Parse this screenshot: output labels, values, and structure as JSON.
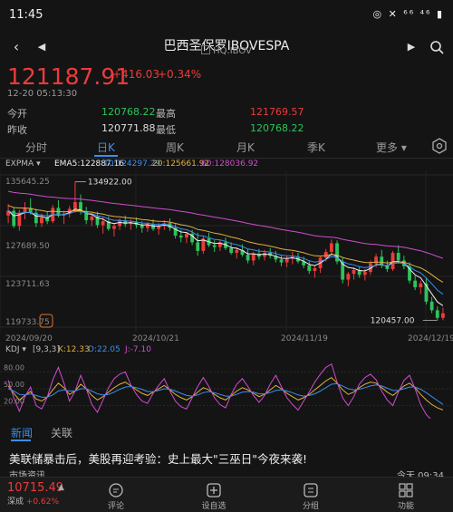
{
  "status": {
    "time": "11:45",
    "icons_text": "◎ ✕ ⁶⁶ ⁴⁶ ▮"
  },
  "nav": {
    "title": "巴西圣保罗IBOVESPA",
    "subtitle": "HQ.IBOV"
  },
  "quote": {
    "price": "121187.91",
    "change": "+416.03",
    "change_pct": "+0.34%",
    "time": "12-20 05:13:30",
    "open_label": "今开",
    "open": "120768.22",
    "high_label": "最高",
    "high": "121769.57",
    "prev_label": "昨收",
    "prev": "120771.88",
    "low_label": "最低",
    "low": "120768.22"
  },
  "tabs": [
    "分时",
    "日K",
    "周K",
    "月K",
    "季K",
    "更多"
  ],
  "active_tab": 1,
  "indicator": {
    "name": "EXPMA",
    "ema5": "EMA5:122887.16",
    "ema10": "10:124297.29",
    "ema20": "20:125661.92",
    "ema60": "60:128036.92"
  },
  "kdj": {
    "name": "KDJ",
    "params": "[9,3,3]",
    "k": "K:12.33",
    "d": "D:22.05",
    "j": "J:-7.10"
  },
  "chart_data": {
    "type": "candlestick",
    "y_ticks": [
      "135645.25",
      "127689.50",
      "123711.63",
      "119733.75"
    ],
    "ylim": [
      119733.75,
      135645.25
    ],
    "max_label": "134922.00",
    "min_label": "120457.00",
    "x_ticks": [
      "2024/09/20",
      "2024/10/21",
      "2024/11/19",
      "2024/12/19"
    ],
    "kdj_ticks": [
      "80.00",
      "50.00",
      "20.00"
    ],
    "kdj_ylim": [
      0,
      100
    ],
    "candles": [
      [
        131400,
        132600,
        130600,
        131900
      ],
      [
        131900,
        132200,
        130100,
        130300
      ],
      [
        130300,
        132000,
        129800,
        131700
      ],
      [
        131700,
        132800,
        131000,
        132200
      ],
      [
        132200,
        133200,
        131500,
        131700
      ],
      [
        131700,
        132100,
        130200,
        130600
      ],
      [
        130600,
        131600,
        130200,
        131200
      ],
      [
        131200,
        131800,
        130500,
        130800
      ],
      [
        130800,
        132500,
        130600,
        132200
      ],
      [
        132200,
        133000,
        131200,
        131400
      ],
      [
        131400,
        131900,
        130500,
        131600
      ],
      [
        131600,
        132400,
        131200,
        132100
      ],
      [
        132100,
        134922,
        131700,
        132800
      ],
      [
        132800,
        133600,
        131500,
        131800
      ],
      [
        131800,
        132300,
        130500,
        130900
      ],
      [
        130900,
        131600,
        130300,
        131300
      ],
      [
        131300,
        131800,
        130100,
        130400
      ],
      [
        130400,
        131200,
        129500,
        130800
      ],
      [
        130800,
        131300,
        129800,
        130000
      ],
      [
        130000,
        130600,
        129200,
        130300
      ],
      [
        130300,
        131100,
        129900,
        130900
      ],
      [
        130900,
        131400,
        130200,
        130500
      ],
      [
        130500,
        131000,
        129900,
        130700
      ],
      [
        130700,
        131200,
        130100,
        130400
      ],
      [
        130400,
        130800,
        129600,
        130100
      ],
      [
        130100,
        130700,
        129700,
        130500
      ],
      [
        130500,
        131000,
        129800,
        130000
      ],
      [
        130000,
        130600,
        129400,
        130300
      ],
      [
        130300,
        130900,
        129900,
        130600
      ],
      [
        130600,
        131100,
        129800,
        130100
      ],
      [
        130100,
        130500,
        129000,
        129300
      ],
      [
        129300,
        129900,
        128600,
        129100
      ],
      [
        129100,
        129700,
        128500,
        129500
      ],
      [
        129500,
        129900,
        128300,
        128600
      ],
      [
        128600,
        129600,
        127200,
        127700
      ],
      [
        127700,
        129200,
        127400,
        129000
      ],
      [
        129000,
        129600,
        128100,
        128300
      ],
      [
        128300,
        128800,
        127600,
        128100
      ],
      [
        128100,
        128900,
        127700,
        128600
      ],
      [
        128600,
        129100,
        127800,
        128000
      ],
      [
        128000,
        128600,
        127300,
        127500
      ],
      [
        127500,
        128100,
        126900,
        127800
      ],
      [
        127800,
        128400,
        127100,
        127300
      ],
      [
        127300,
        127900,
        126400,
        126700
      ],
      [
        126700,
        127600,
        126200,
        127400
      ],
      [
        127400,
        127900,
        126800,
        127100
      ],
      [
        127100,
        127800,
        126700,
        127500
      ],
      [
        127500,
        128000,
        126900,
        127200
      ],
      [
        127200,
        127700,
        126500,
        126800
      ],
      [
        126800,
        127300,
        126100,
        126500
      ],
      [
        126500,
        127200,
        126000,
        126900
      ],
      [
        126900,
        127600,
        126300,
        127100
      ],
      [
        127100,
        127500,
        126400,
        126600
      ],
      [
        126600,
        127100,
        125900,
        126200
      ],
      [
        126200,
        126700,
        125300,
        125600
      ],
      [
        125600,
        126200,
        124900,
        125900
      ],
      [
        125900,
        127200,
        125400,
        127000
      ],
      [
        127000,
        127900,
        126600,
        127600
      ],
      [
        127600,
        128900,
        127200,
        128500
      ],
      [
        128500,
        128800,
        126300,
        126600
      ],
      [
        126600,
        127000,
        124300,
        124700
      ],
      [
        124700,
        125500,
        124000,
        125300
      ],
      [
        125300,
        126000,
        124700,
        125700
      ],
      [
        125700,
        126100,
        124900,
        125200
      ],
      [
        125200,
        125800,
        124600,
        125500
      ],
      [
        125500,
        126700,
        125200,
        126400
      ],
      [
        126400,
        127400,
        126000,
        127100
      ],
      [
        127100,
        127800,
        125900,
        126200
      ],
      [
        126200,
        126700,
        125500,
        125800
      ],
      [
        125800,
        127700,
        125600,
        127500
      ],
      [
        127500,
        128300,
        126400,
        126700
      ],
      [
        126700,
        127200,
        125800,
        126100
      ],
      [
        126100,
        126500,
        124300,
        124600
      ],
      [
        124600,
        125100,
        123600,
        123900
      ],
      [
        123900,
        124600,
        123200,
        124300
      ],
      [
        124300,
        124900,
        122100,
        122400
      ],
      [
        122400,
        122900,
        121200,
        121500
      ],
      [
        121500,
        121900,
        120457,
        120700
      ],
      [
        120700,
        121769,
        120457,
        121188
      ]
    ],
    "kdj_k": [
      55,
      42,
      30,
      38,
      45,
      32,
      28,
      35,
      48,
      60,
      52,
      40,
      46,
      58,
      50,
      38,
      30,
      36,
      44,
      52,
      58,
      62,
      55,
      48,
      42,
      38,
      44,
      50,
      56,
      48,
      40,
      34,
      30,
      36,
      44,
      52,
      48,
      40,
      34,
      30,
      38,
      46,
      52,
      48,
      42,
      36,
      40,
      48,
      56,
      50,
      42,
      36,
      30,
      34,
      40,
      48,
      56,
      64,
      70,
      60,
      48,
      40,
      44,
      52,
      58,
      62,
      60,
      52,
      44,
      38,
      46,
      55,
      60,
      52,
      40,
      30,
      22,
      16,
      12.33
    ],
    "kdj_d": [
      50,
      46,
      40,
      39,
      41,
      38,
      35,
      35,
      39,
      46,
      48,
      46,
      46,
      50,
      50,
      46,
      41,
      39,
      40,
      44,
      49,
      53,
      54,
      52,
      49,
      45,
      45,
      47,
      50,
      49,
      46,
      42,
      38,
      37,
      39,
      43,
      45,
      43,
      40,
      37,
      37,
      40,
      44,
      45,
      44,
      41,
      41,
      43,
      47,
      48,
      46,
      43,
      39,
      37,
      38,
      41,
      46,
      52,
      58,
      59,
      55,
      50,
      48,
      49,
      52,
      55,
      57,
      55,
      51,
      47,
      47,
      50,
      53,
      53,
      49,
      43,
      36,
      29,
      22.05
    ],
    "kdj_j": [
      65,
      34,
      10,
      36,
      53,
      20,
      14,
      35,
      66,
      88,
      60,
      28,
      46,
      74,
      50,
      22,
      8,
      30,
      52,
      68,
      76,
      80,
      57,
      40,
      28,
      24,
      42,
      56,
      68,
      46,
      28,
      18,
      14,
      34,
      54,
      70,
      54,
      34,
      22,
      16,
      40,
      58,
      68,
      54,
      38,
      26,
      38,
      58,
      74,
      54,
      34,
      22,
      12,
      28,
      44,
      62,
      76,
      88,
      94,
      62,
      34,
      20,
      36,
      58,
      70,
      76,
      66,
      46,
      30,
      20,
      44,
      65,
      74,
      50,
      22,
      4,
      -6,
      -10,
      -7.1
    ]
  },
  "news": {
    "tabs": [
      "新闻",
      "关联"
    ],
    "headline": "美联储暴击后，美股再迎考验：史上最大\"三巫日\"今夜来袭!",
    "source": "市场资讯",
    "time": "今天 09:34"
  },
  "bottom": {
    "ticker_price": "10715.49",
    "ticker_name": "深成",
    "ticker_chg": "+0.62%",
    "items": [
      "评论",
      "设自选",
      "分组",
      "功能"
    ]
  }
}
